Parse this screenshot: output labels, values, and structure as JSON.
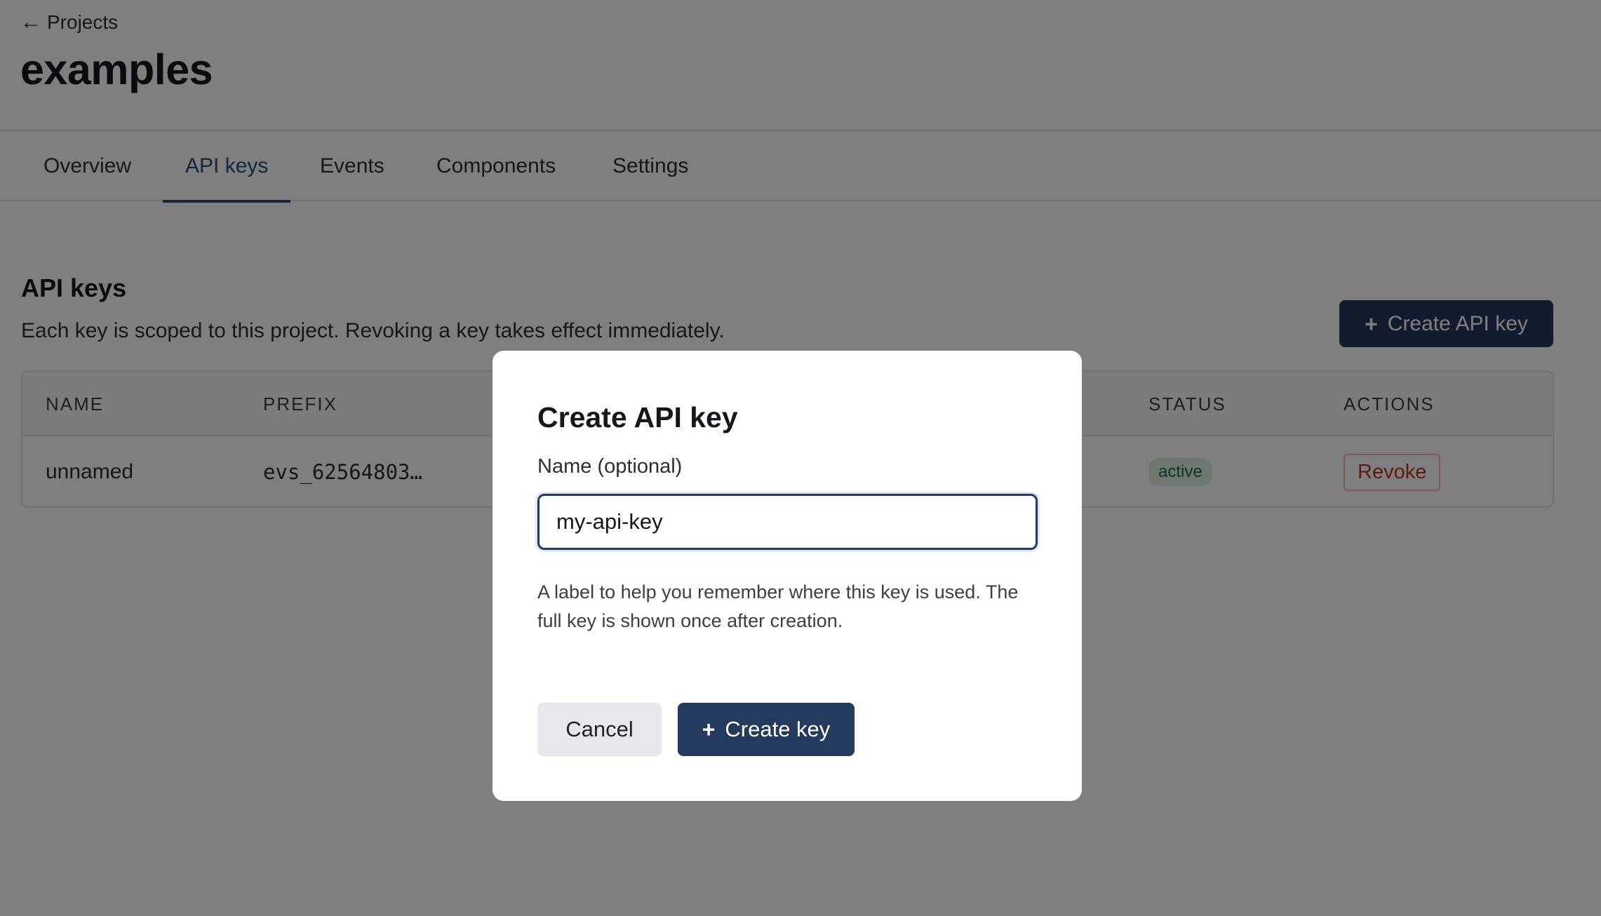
{
  "header": {
    "back_arrow": "←",
    "back_label": "Projects",
    "project_name": "examples"
  },
  "tabs": [
    {
      "label": "Overview",
      "active": false
    },
    {
      "label": "API keys",
      "active": true
    },
    {
      "label": "Events",
      "active": false
    },
    {
      "label": "Components",
      "active": false
    },
    {
      "label": "Settings",
      "active": false
    }
  ],
  "section": {
    "title": "API keys",
    "description": "Each key is scoped to this project. Revoking a key takes effect immediately.",
    "create_button_label": "Create API key",
    "create_button_icon": "plus-icon"
  },
  "table": {
    "columns": [
      "NAME",
      "PREFIX",
      "STATUS",
      "ACTIONS"
    ],
    "rows": [
      {
        "name": "unnamed",
        "prefix": "evs_62564803…",
        "status": "active",
        "action": "Revoke"
      }
    ]
  },
  "modal": {
    "title": "Create API key",
    "field_label": "Name (optional)",
    "input_value": "my-api-key",
    "help_text": "A label to help you remember where this key is used. The full key is shown once after creation.",
    "cancel_label": "Cancel",
    "create_label": "Create key",
    "create_icon": "plus-icon"
  },
  "colors": {
    "accent": "#233a5e",
    "active_tab": "#2d4a72",
    "status_active_bg": "#dcefe0",
    "status_active_text": "#1e6b34",
    "danger": "#c4302b",
    "overlay": "rgba(0,0,0,0.5)"
  }
}
